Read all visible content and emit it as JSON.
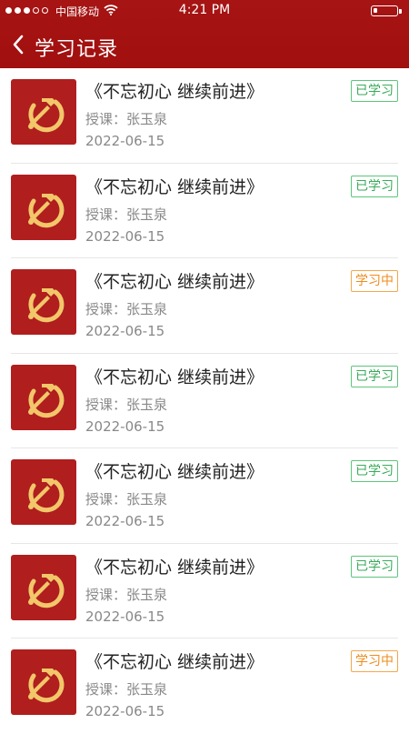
{
  "status_bar": {
    "carrier": "中国移动",
    "time": "4:21 PM"
  },
  "header": {
    "title": "学习记录"
  },
  "records": [
    {
      "title": "《不忘初心   继续前进》",
      "teacher": "授课：张玉泉",
      "date": "2022-06-15",
      "status": "已学习",
      "state": "done"
    },
    {
      "title": "《不忘初心   继续前进》",
      "teacher": "授课：张玉泉",
      "date": "2022-06-15",
      "status": "已学习",
      "state": "done"
    },
    {
      "title": "《不忘初心   继续前进》",
      "teacher": "授课：张玉泉",
      "date": "2022-06-15",
      "status": "学习中",
      "state": "doing"
    },
    {
      "title": "《不忘初心   继续前进》",
      "teacher": "授课：张玉泉",
      "date": "2022-06-15",
      "status": "已学习",
      "state": "done"
    },
    {
      "title": "《不忘初心   继续前进》",
      "teacher": "授课：张玉泉",
      "date": "2022-06-15",
      "status": "已学习",
      "state": "done"
    },
    {
      "title": "《不忘初心   继续前进》",
      "teacher": "授课：张玉泉",
      "date": "2022-06-15",
      "status": "已学习",
      "state": "done"
    },
    {
      "title": "《不忘初心   继续前进》",
      "teacher": "授课：张玉泉",
      "date": "2022-06-15",
      "status": "学习中",
      "state": "doing"
    }
  ],
  "colors": {
    "header": "#a61414",
    "thumbnail": "#b01e1e",
    "emblem": "#f2c76a",
    "status_done": "#3aaa5a",
    "status_doing": "#ee8c1e"
  },
  "icons": {
    "back": "chevron-left-icon",
    "thumbnail": "hammer-sickle-icon"
  }
}
